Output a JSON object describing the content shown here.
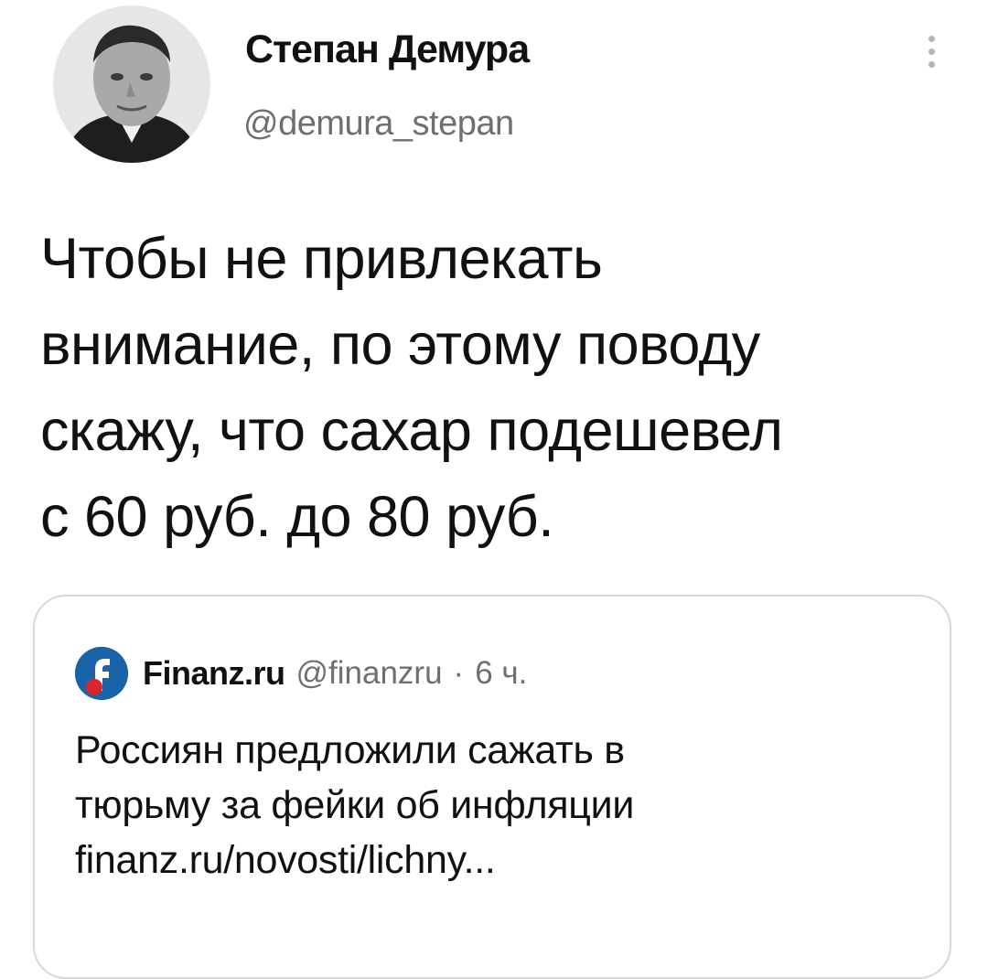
{
  "author": {
    "display_name": "Степан Демура",
    "handle": "@demura_stepan",
    "avatar_icon": "avatar-portrait"
  },
  "more_icon": "vertical-ellipsis-icon",
  "tweet": {
    "lines": [
      "Чтобы не привлекать",
      "внимание, по этому поводу",
      "скажу, что сахар подешевел",
      "с 60 руб. до 80 руб."
    ]
  },
  "quote": {
    "logo_icon": "finanz-logo-icon",
    "name": "Finanz.ru",
    "handle": "@finanzru",
    "separator": "·",
    "time": "6 ч.",
    "lines": [
      "Россиян предложили сажать в",
      "тюрьму за фейки об инфляции",
      "finanz.ru/novosti/lichny..."
    ]
  },
  "colors": {
    "text": "#111111",
    "secondary_text": "#6f6f6f",
    "card_border": "#d8d8d8",
    "logo_blue": "#1b63a8",
    "logo_red": "#d8262b"
  }
}
